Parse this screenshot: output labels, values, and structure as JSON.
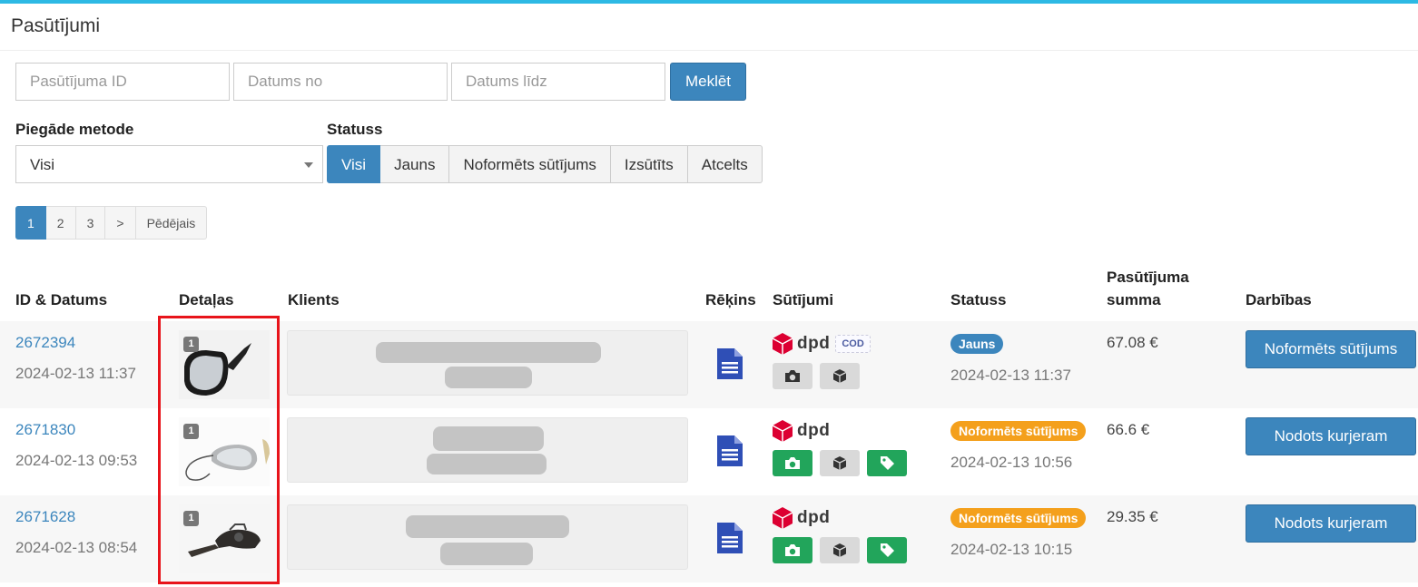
{
  "page": {
    "title": "Pasūtījumi"
  },
  "filters": {
    "order_id_placeholder": "Pasūtījuma ID",
    "date_from_placeholder": "Datums no",
    "date_to_placeholder": "Datums līdz",
    "search_label": "Meklēt",
    "delivery_label": "Piegāde metode",
    "delivery_value": "Visi",
    "status_label": "Statuss",
    "status_options": [
      "Visi",
      "Jauns",
      "Noformēts sūtījums",
      "Izsūtīts",
      "Atcelts"
    ],
    "status_selected": "Visi"
  },
  "pagination": {
    "pages": [
      "1",
      "2",
      "3",
      ">",
      "Pēdējais"
    ],
    "current": "1"
  },
  "table": {
    "headers": {
      "id_date": "ID & Datums",
      "details": "Detaļas",
      "client": "Klients",
      "invoice": "Rēķins",
      "shipments": "Sūtījumi",
      "status": "Statuss",
      "sum_line1": "Pasūtījuma",
      "sum_line2": "summa",
      "actions": "Darbības"
    },
    "rows": [
      {
        "id": "2672394",
        "date": "2024-02-13 11:37",
        "qty": "1",
        "carrier": "dpd",
        "cod": "COD",
        "status": "Jauns",
        "status_color": "#3c86bd",
        "status_date": "2024-02-13 11:37",
        "sum": "67.08 €",
        "action": "Noformēts sūtījums"
      },
      {
        "id": "2671830",
        "date": "2024-02-13 09:53",
        "qty": "1",
        "carrier": "dpd",
        "cod": "",
        "status": "Noformēts sūtījums",
        "status_color": "#f4a01c",
        "status_date": "2024-02-13 10:56",
        "sum": "66.6 €",
        "action": "Nodots kurjeram"
      },
      {
        "id": "2671628",
        "date": "2024-02-13 08:54",
        "qty": "1",
        "carrier": "dpd",
        "cod": "",
        "status": "Noformēts sūtījums",
        "status_color": "#f4a01c",
        "status_date": "2024-02-13 10:15",
        "sum": "29.35 €",
        "action": "Nodots kurjeram"
      }
    ]
  },
  "colors": {
    "accent": "#3c86bd",
    "green": "#22a55b",
    "orange": "#f4a01c",
    "dpd_red": "#dc0032",
    "highlight": "#e8141b"
  },
  "icons": [
    "document-icon",
    "camera-icon",
    "box-icon",
    "tag-icon",
    "dpd-cube-icon",
    "caret-down-icon"
  ]
}
